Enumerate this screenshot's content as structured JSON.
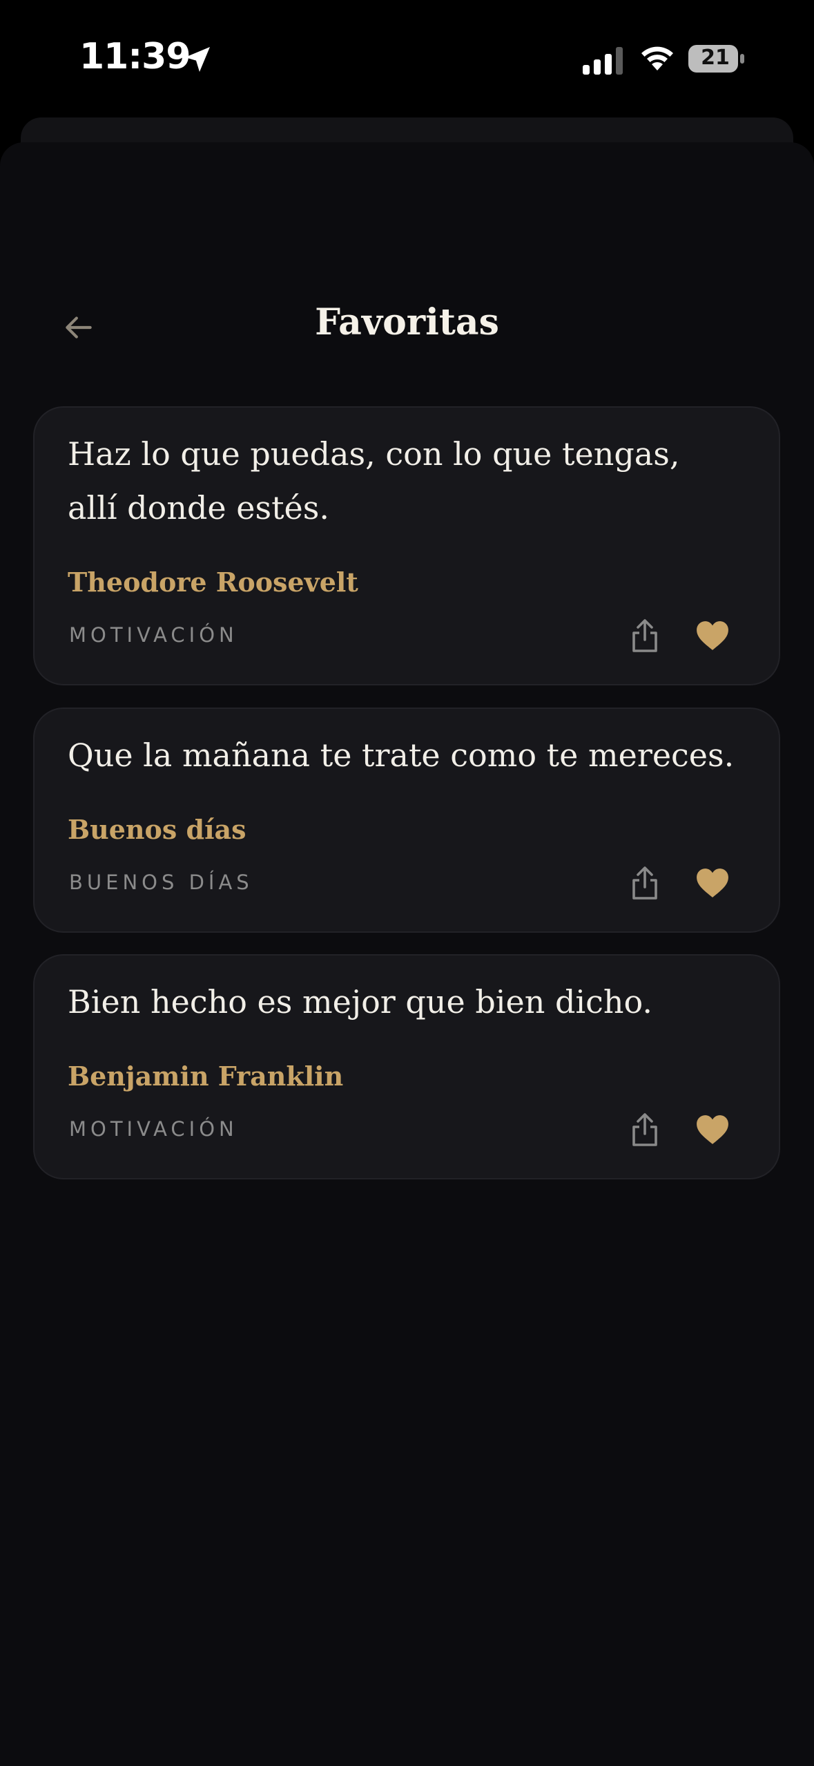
{
  "status_bar": {
    "time": "11:39",
    "battery_level": "21",
    "icons": [
      "location-arrow-icon",
      "cellular-signal-icon",
      "wifi-icon",
      "battery-icon"
    ]
  },
  "header": {
    "title": "Favoritas",
    "back_icon": "arrow-left-icon"
  },
  "favorites": [
    {
      "text": "Haz lo que puedas, con lo que tengas, allí donde estés.",
      "author": "Theodore Roosevelt",
      "category": "MOTIVACIÓN"
    },
    {
      "text": "Que la mañana te trate como te mereces.",
      "author": "Buenos días",
      "category": "BUENOS DÍAS"
    },
    {
      "text": "Bien hecho es mejor que bien dicho.",
      "author": "Benjamin Franklin",
      "category": "MOTIVACIÓN"
    }
  ],
  "card_icons": [
    "share-icon",
    "heart-icon"
  ],
  "colors": {
    "background": "#0c0c0f",
    "card": "#17171b",
    "accent_gold": "#c9a467",
    "text_primary": "#f2efe8",
    "text_muted": "#8b8b8b"
  }
}
